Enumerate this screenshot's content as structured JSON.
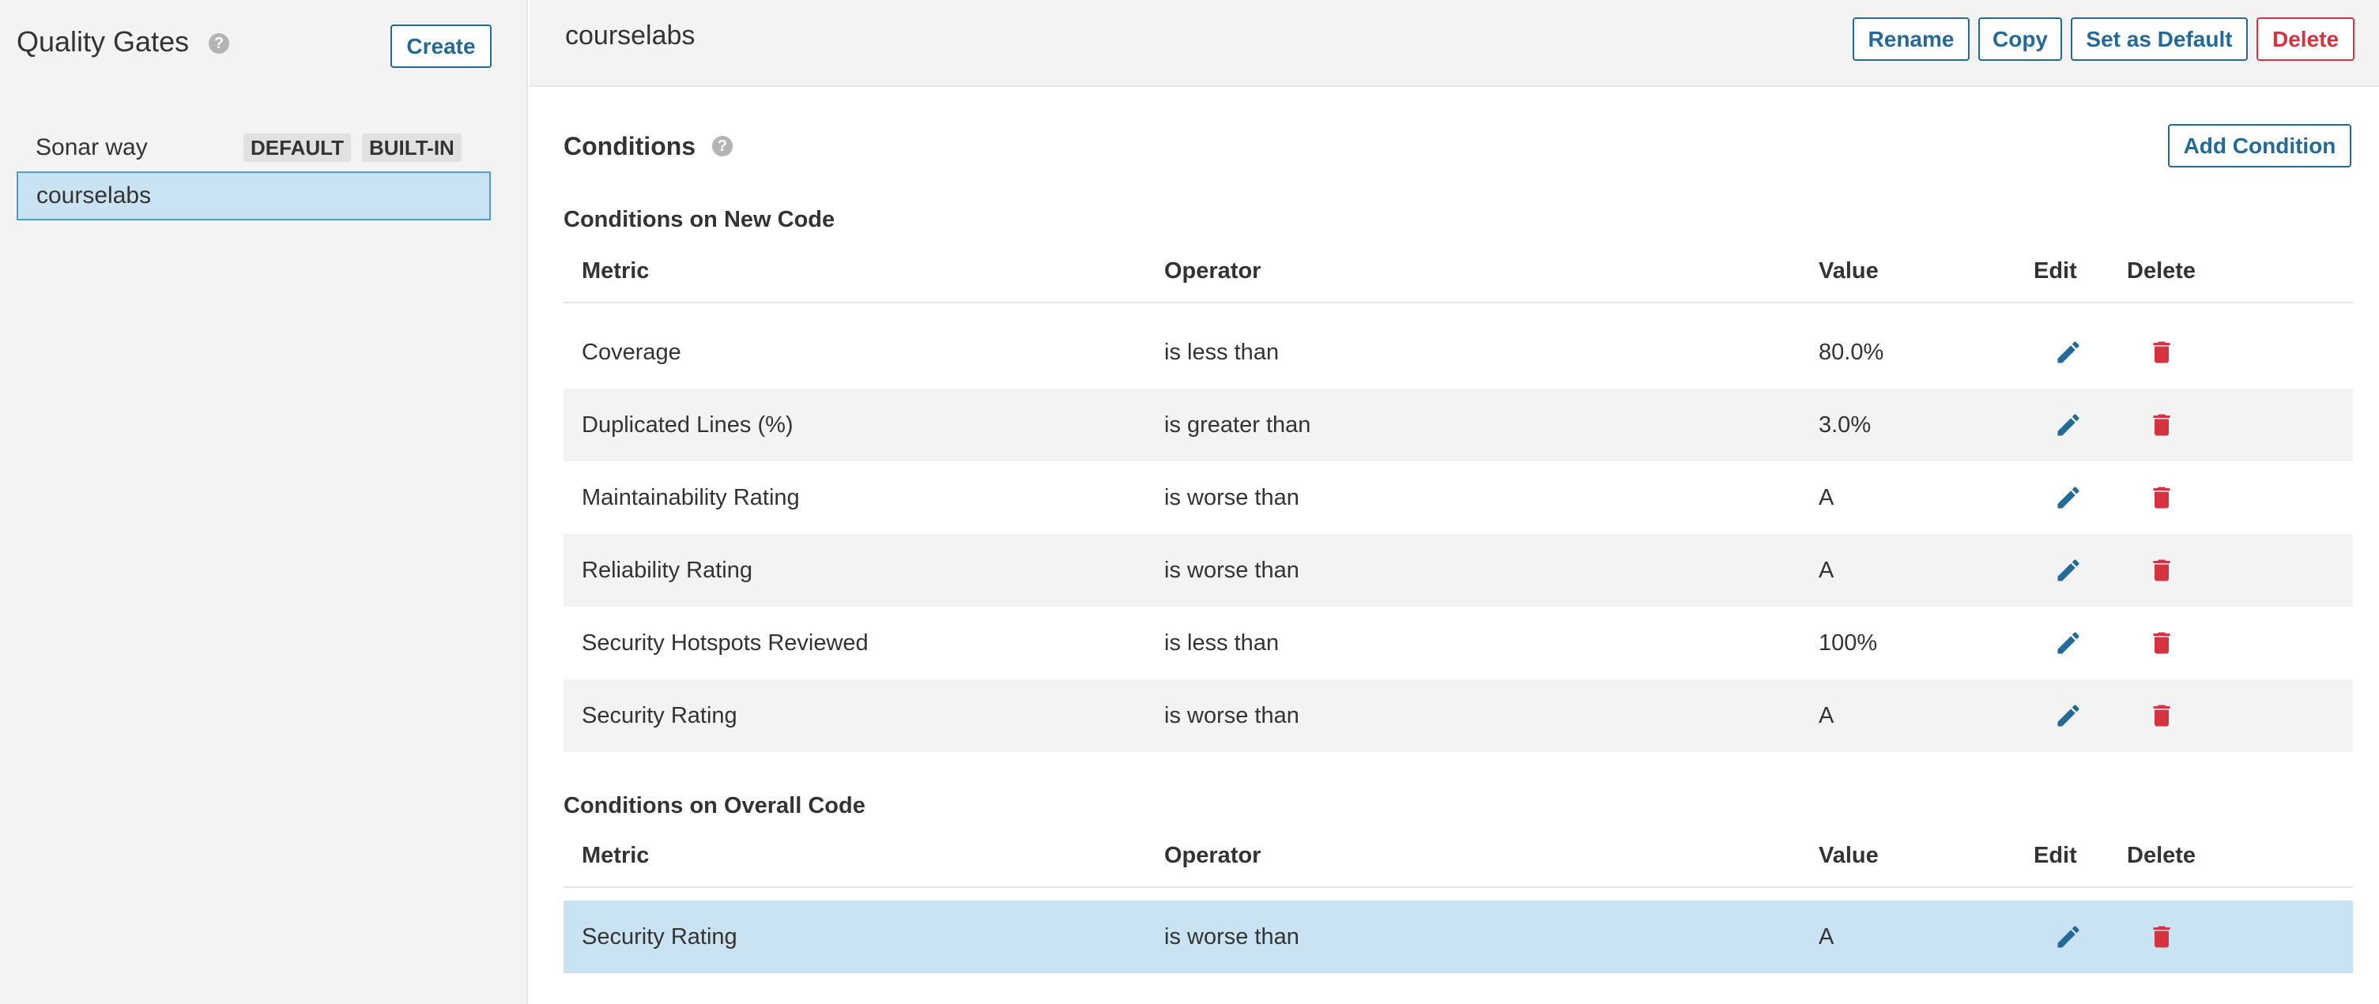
{
  "sidebar": {
    "title": "Quality Gates",
    "help_icon": "?",
    "create_label": "Create",
    "gates": [
      {
        "name": "Sonar way",
        "badges": [
          "DEFAULT",
          "BUILT-IN"
        ]
      },
      {
        "name": "courselabs",
        "selected": true
      }
    ]
  },
  "header": {
    "gate_name": "courselabs",
    "rename_label": "Rename",
    "copy_label": "Copy",
    "set_default_label": "Set as Default",
    "delete_label": "Delete"
  },
  "conditions": {
    "title": "Conditions",
    "help_icon": "?",
    "add_label": "Add Condition",
    "columns": {
      "metric": "Metric",
      "operator": "Operator",
      "value": "Value",
      "edit": "Edit",
      "delete": "Delete"
    },
    "new_code": {
      "title": "Conditions on New Code",
      "rows": [
        {
          "metric": "Coverage",
          "operator": "is less than",
          "value": "80.0%"
        },
        {
          "metric": "Duplicated Lines (%)",
          "operator": "is greater than",
          "value": "3.0%"
        },
        {
          "metric": "Maintainability Rating",
          "operator": "is worse than",
          "value": "A"
        },
        {
          "metric": "Reliability Rating",
          "operator": "is worse than",
          "value": "A"
        },
        {
          "metric": "Security Hotspots Reviewed",
          "operator": "is less than",
          "value": "100%"
        },
        {
          "metric": "Security Rating",
          "operator": "is worse than",
          "value": "A"
        }
      ]
    },
    "overall_code": {
      "title": "Conditions on Overall Code",
      "rows": [
        {
          "metric": "Security Rating",
          "operator": "is worse than",
          "value": "A",
          "selected": true
        }
      ]
    }
  },
  "colors": {
    "accent": "#236a97",
    "danger": "#d4333f",
    "selected_bg": "#cae3f2",
    "selected_border": "#4b9fd5",
    "panel_bg": "#f3f3f3"
  }
}
